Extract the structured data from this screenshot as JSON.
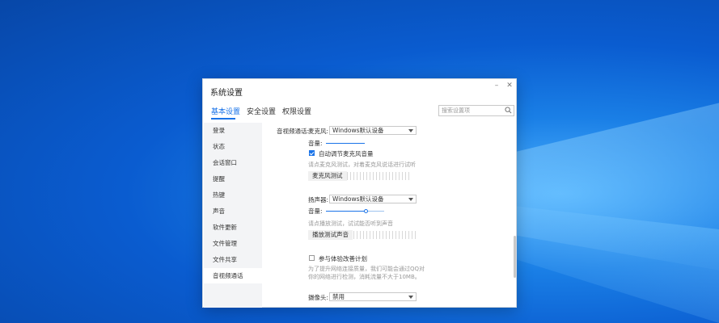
{
  "window": {
    "title": "系统设置"
  },
  "tabs": [
    {
      "label": "基本设置",
      "active": true
    },
    {
      "label": "安全设置",
      "active": false
    },
    {
      "label": "权限设置",
      "active": false
    }
  ],
  "search": {
    "placeholder": "搜索设置项"
  },
  "sidebar": {
    "items": [
      {
        "label": "登录"
      },
      {
        "label": "状态"
      },
      {
        "label": "会话窗口"
      },
      {
        "label": "提醒"
      },
      {
        "label": "热键"
      },
      {
        "label": "声音"
      },
      {
        "label": "软件更新"
      },
      {
        "label": "文件管理"
      },
      {
        "label": "文件共享"
      },
      {
        "label": "音视频通话",
        "active": true
      }
    ]
  },
  "av": {
    "section_label": "音视频通话:",
    "mic": {
      "label": "麦克风:",
      "device": "Windows默认设备",
      "volume_label": "音量:",
      "volume": 1.0,
      "auto_adjust_label": "自动调节麦克风音量",
      "auto_adjust": true,
      "hint": "请点麦克风测试，对着麦克风说话进行试听",
      "test_button": "麦克风测试"
    },
    "speaker": {
      "label": "扬声器:",
      "device": "Windows默认设备",
      "volume_label": "音量:",
      "volume": 0.7,
      "hint": "请点播放测试，试试能否听到声音",
      "test_button": "播放测试声音"
    },
    "experience": {
      "label": "参与体验改善计划",
      "checked": false,
      "hint_line1": "为了提升网络连接质量，我们可能会通过QQ对",
      "hint_line2": "你的网络进行检测，消耗流量不大于10MB。"
    },
    "camera": {
      "label": "摄像头:",
      "device": "禁用"
    }
  },
  "colors": {
    "accent": "#1a73e8",
    "sidebar_bg": "#f3f4f6",
    "desktop": "#0a5cd0"
  },
  "icons": {
    "search": "search-icon",
    "minimize": "minimize-icon",
    "close": "close-icon"
  }
}
